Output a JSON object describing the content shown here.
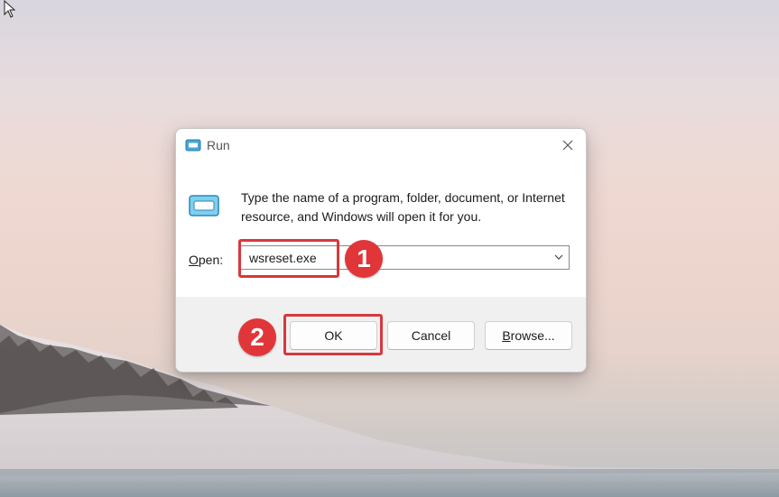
{
  "dialog": {
    "title": "Run",
    "close_icon": "close-icon",
    "app_icon": "run-icon",
    "description": "Type the name of a program, folder, document, or Internet resource, and Windows will open it for you.",
    "open_label_accel": "O",
    "open_label_rest": "pen:",
    "open_value": "wsreset.exe",
    "buttons": {
      "ok": "OK",
      "cancel": "Cancel",
      "browse_accel": "B",
      "browse_rest": "rowse..."
    }
  },
  "annotations": {
    "step1": "1",
    "step2": "2",
    "highlight_color": "#d8373c"
  },
  "colors": {
    "badge": "#e0363a"
  }
}
